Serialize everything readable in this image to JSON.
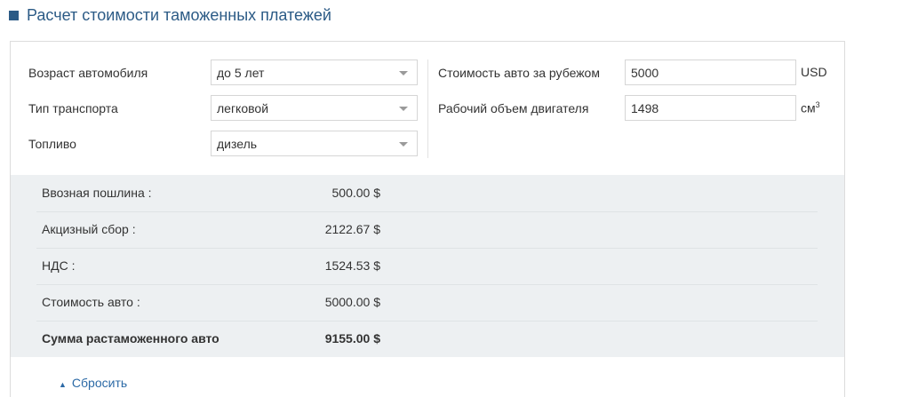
{
  "page": {
    "title": "Расчет стоимости таможенных платежей"
  },
  "form": {
    "age": {
      "label": "Возраст автомобиля",
      "value": "до 5 лет"
    },
    "transport": {
      "label": "Тип транспорта",
      "value": "легковой"
    },
    "fuel": {
      "label": "Топливо",
      "value": "дизель"
    },
    "price": {
      "label": "Стоимость авто за рубежом",
      "value": "5000",
      "unit": "USD"
    },
    "engine": {
      "label": "Рабочий объем двигателя",
      "value": "1498",
      "unit": "см",
      "unit_sup": "3"
    }
  },
  "results": [
    {
      "label": "Ввозная пошлина :",
      "value": "500.00 $",
      "bold": false
    },
    {
      "label": "Акцизный сбор :",
      "value": "2122.67 $",
      "bold": false
    },
    {
      "label": "НДС :",
      "value": "1524.53 $",
      "bold": false
    },
    {
      "label": "Стоимость авто :",
      "value": "5000.00 $",
      "bold": false
    },
    {
      "label": "Сумма растаможенного авто",
      "value": "9155.00 $",
      "bold": true
    }
  ],
  "reset": {
    "arrow": "▲",
    "label": "Сбросить"
  },
  "colors": {
    "accent": "#2c5b86",
    "results_bg": "#edf0f2",
    "link": "#2c6aa6"
  }
}
